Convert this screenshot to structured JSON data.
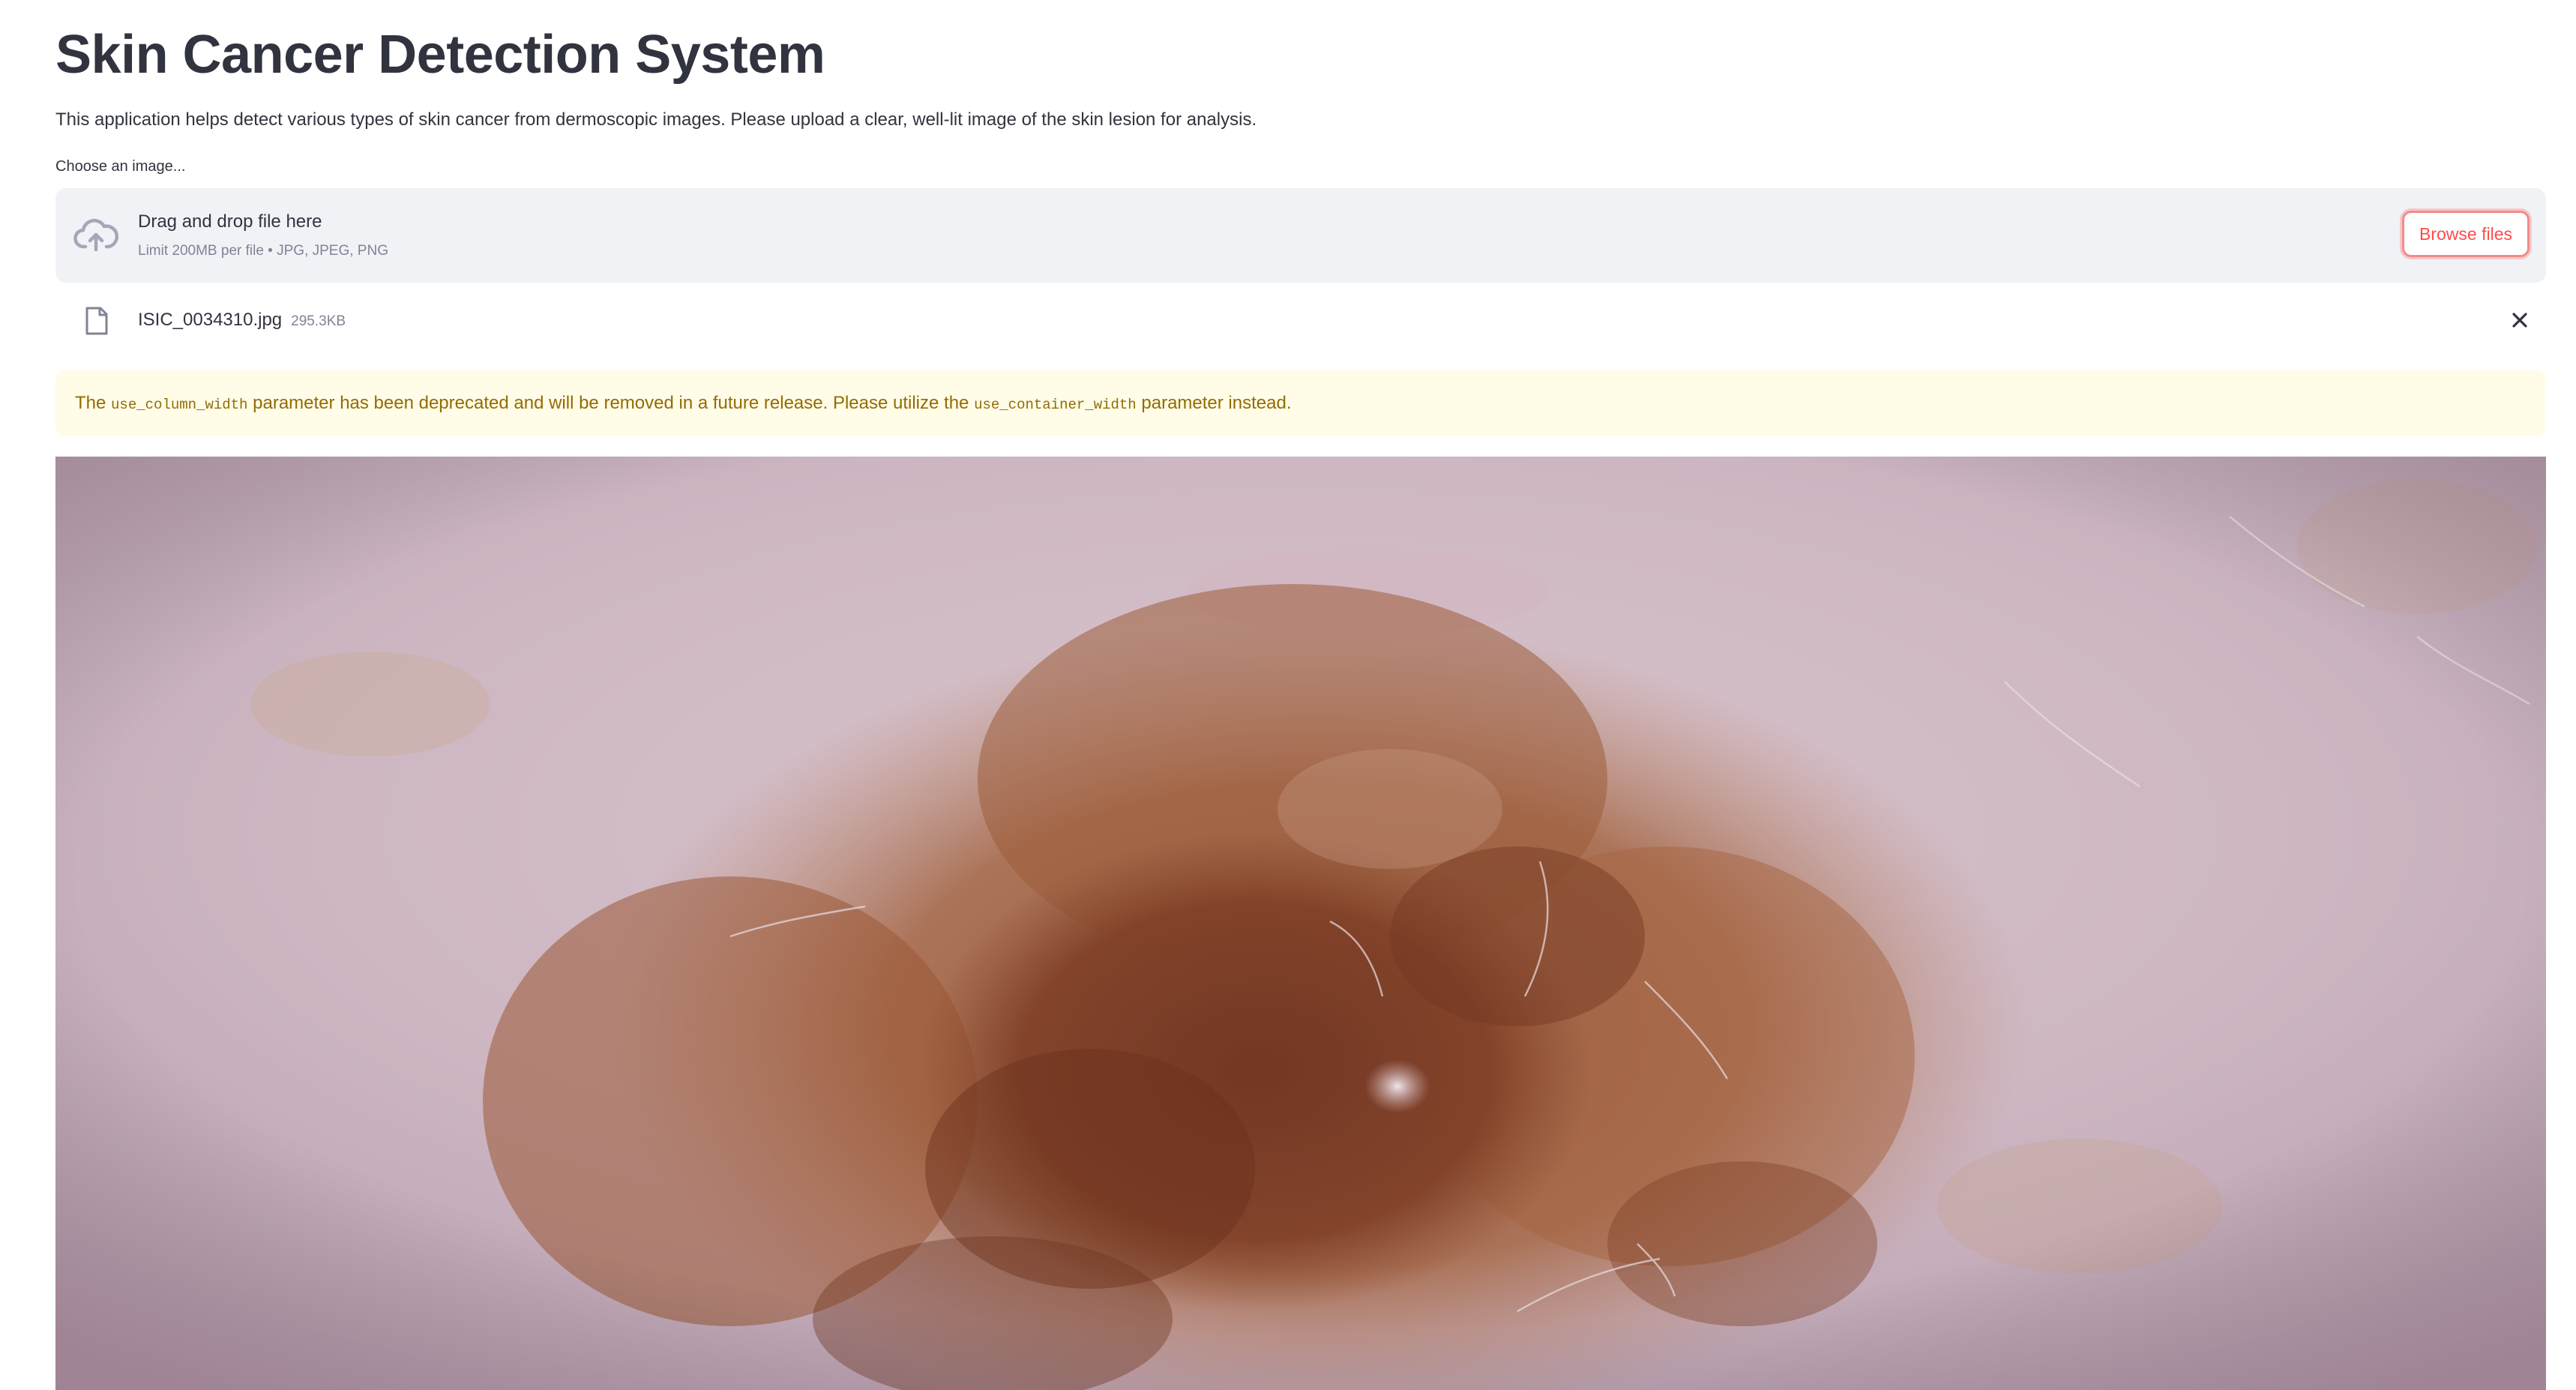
{
  "page": {
    "title": "Skin Cancer Detection System",
    "intro": "This application helps detect various types of skin cancer from dermoscopic images. Please upload a clear, well-lit image of the skin lesion for analysis."
  },
  "uploader": {
    "label": "Choose an image...",
    "drop_title": "Drag and drop file here",
    "drop_subtitle": "Limit 200MB per file • JPG, JPEG, PNG",
    "browse_label": "Browse files",
    "cloud_icon": "cloud-upload-icon"
  },
  "uploaded_file": {
    "name": "ISIC_0034310.jpg",
    "size": "295.3KB",
    "file_icon": "file-icon",
    "remove_icon": "close-icon"
  },
  "warning": {
    "prefix": "The",
    "param_old": "use_column_width",
    "middle": "parameter has been deprecated and will be removed in a future release. Please utilize the",
    "param_new": "use_container_width",
    "suffix": "parameter instead."
  },
  "colors": {
    "primary": "#ff4b4b",
    "text": "#31333f",
    "muted": "#808495",
    "dropzone_bg": "#f0f2f6",
    "warning_bg": "#fffce7",
    "warning_text": "#926c05"
  }
}
